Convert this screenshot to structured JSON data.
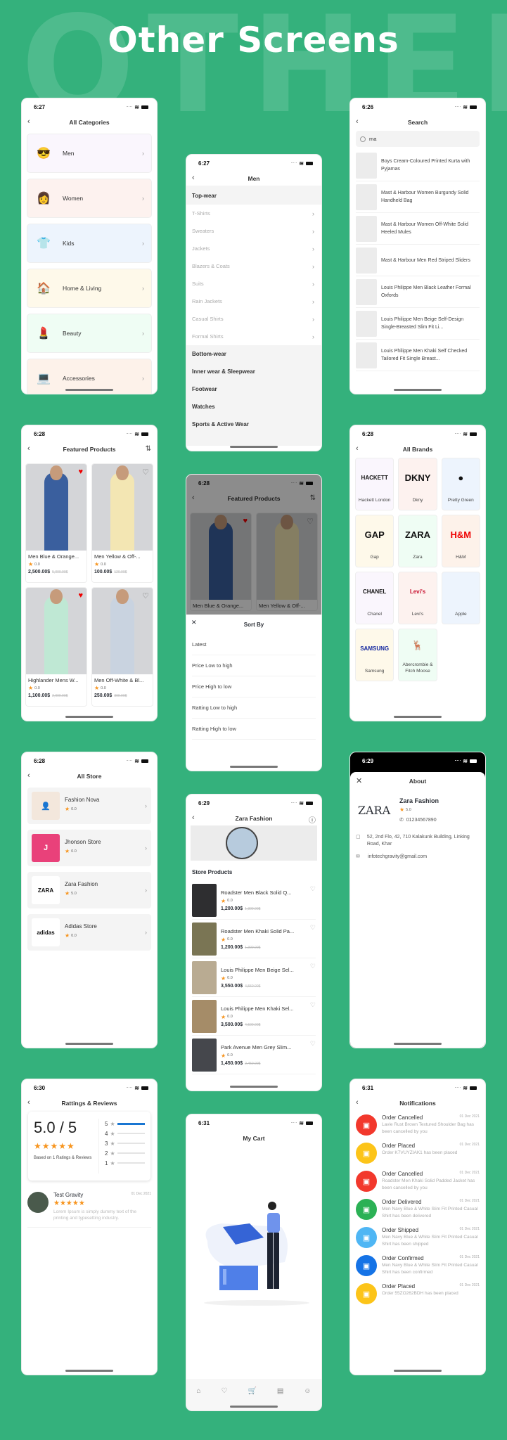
{
  "page": {
    "bg_word": "OTHER",
    "title": "Other Screens",
    "accent": "#34b17c",
    "star_color": "#f7941d"
  },
  "categories": {
    "time": "6:27",
    "title": "All Categories",
    "items": [
      {
        "label": "Men",
        "bg": "#faf6fd",
        "icon": "😎"
      },
      {
        "label": "Women",
        "bg": "#fdf2ef",
        "icon": "👩"
      },
      {
        "label": "Kids",
        "bg": "#edf4fd",
        "icon": "👕"
      },
      {
        "label": "Home & Living",
        "bg": "#fef9ea",
        "icon": "🏠"
      },
      {
        "label": "Beauty",
        "bg": "#effdf4",
        "icon": "💄"
      },
      {
        "label": "Accessories",
        "bg": "#fdf2ea",
        "icon": "💻"
      }
    ]
  },
  "men": {
    "time": "6:27",
    "title": "Men",
    "sections": [
      {
        "label": "Top-wear",
        "subs": [
          "T-Shirts",
          "Sweaters",
          "Jackets",
          "Blazers & Coats",
          "Suits",
          "Rain Jackets",
          "Casual Shirts",
          "Formal Shirts"
        ]
      },
      {
        "label": "Bottom-wear",
        "subs": []
      },
      {
        "label": "Inner wear & Sleepwear",
        "subs": []
      },
      {
        "label": "Footwear",
        "subs": []
      },
      {
        "label": "Watches",
        "subs": []
      },
      {
        "label": "Sports & Active Wear",
        "subs": []
      }
    ]
  },
  "search": {
    "time": "6:26",
    "title": "Search",
    "query": "ma",
    "results": [
      "Boys Cream-Coloured Printed Kurta with Pyjamas",
      "Mast & Harbour Women Burgundy Solid Handheld Bag",
      "Mast & Harbour Women Off-White Solid Heeled Mules",
      "Mast & Harbour Men Red Striped Sliders",
      "Louis Philippe Men Black Leather Formal Oxfords",
      "Louis Philippe Men Beige Self-Design Single-Breasted Slim Fit Li...",
      "Louis Philippe Men Khaki Self Checked Tailored Fit Single Breast..."
    ]
  },
  "featured": {
    "time": "6:28",
    "title": "Featured Products",
    "products": [
      {
        "name": "Men Blue & Orange...",
        "rating": "0.0",
        "price": "2,500.00$",
        "old": "5,000.00$",
        "fav": true,
        "color": "#3a5f9e"
      },
      {
        "name": "Men Yellow & Off-...",
        "rating": "0.0",
        "price": "100.00$",
        "old": "120.00$",
        "fav": false,
        "color": "#f3e6b3"
      },
      {
        "name": "Highlander Mens W...",
        "rating": "0.0",
        "price": "1,100.00$",
        "old": "2,000.00$",
        "fav": true,
        "color": "#bfe8d4"
      },
      {
        "name": "Men Off-White & Bl...",
        "rating": "0.0",
        "price": "250.00$",
        "old": "300.00$",
        "fav": false,
        "color": "#c9d3e0"
      }
    ]
  },
  "sort": {
    "time": "6:28",
    "title": "Featured Products",
    "sheet_title": "Sort By",
    "options": [
      "Latest",
      "Price Low to high",
      "Price High to low",
      "Ratting Low to high",
      "Ratting High to low"
    ],
    "peek": [
      "Men Blue & Orange...",
      "Men Yellow & Off-..."
    ]
  },
  "brands": {
    "time": "6:28",
    "title": "All Brands",
    "items": [
      {
        "name": "Hackett London",
        "logo": "HACKETT",
        "bg": "#faf6fd",
        "color": "#111"
      },
      {
        "name": "Dkny",
        "logo": "DKNY",
        "bg": "#fdf2ef",
        "color": "#111"
      },
      {
        "name": "Pretty Green",
        "logo": "●",
        "bg": "#edf4fd",
        "color": "#111"
      },
      {
        "name": "Gap",
        "logo": "GAP",
        "bg": "#fef9ea",
        "color": "#111"
      },
      {
        "name": "Zara",
        "logo": "ZARA",
        "bg": "#effdf4",
        "color": "#111"
      },
      {
        "name": "H&M",
        "logo": "H&M",
        "bg": "#fdf2ea",
        "color": "#e00"
      },
      {
        "name": "Chanel",
        "logo": "CHANEL",
        "bg": "#faf6fd",
        "color": "#111"
      },
      {
        "name": "Levi's",
        "logo": "Levi's",
        "bg": "#fdf2ef",
        "color": "#c8102e"
      },
      {
        "name": "Apple",
        "logo": "",
        "bg": "#edf4fd",
        "color": "#111"
      },
      {
        "name": "Samsung",
        "logo": "SAMSUNG",
        "bg": "#fef9ea",
        "color": "#1428a0"
      },
      {
        "name": "Abercrombie & Fitch Moose",
        "logo": "🦌",
        "bg": "#effdf4",
        "color": "#1d2f6f"
      }
    ]
  },
  "stores": {
    "time": "6:28",
    "title": "All Store",
    "items": [
      {
        "name": "Fashion Nova",
        "rating": "0.0",
        "logo": "👤",
        "logo_bg": "#f3e7dc",
        "logo_color": "#c99a6b"
      },
      {
        "name": "Jhonson Store",
        "rating": "0.0",
        "logo": "J",
        "logo_bg": "#e9417a",
        "logo_color": "#fff"
      },
      {
        "name": "Zara Fashion",
        "rating": "5.0",
        "logo": "ZARA",
        "logo_bg": "#fff",
        "logo_color": "#111"
      },
      {
        "name": "Adidas Store",
        "rating": "0.0",
        "logo": "adidas",
        "logo_bg": "#fff",
        "logo_color": "#111"
      }
    ]
  },
  "zara": {
    "time": "6:29",
    "title": "Zara Fashion",
    "section": "Store Products",
    "products": [
      {
        "name": "Roadster Men Black Solid Q...",
        "rating": "0.0",
        "price": "1,200.00$",
        "old": "1,300.00$",
        "color": "#2e2e30"
      },
      {
        "name": "Roadster Men Khaki Solid Pa...",
        "rating": "0.0",
        "price": "1,200.00$",
        "old": "1,300.00$",
        "color": "#7a7554"
      },
      {
        "name": "Louis Philippe Men Beige Sel...",
        "rating": "0.0",
        "price": "3,550.00$",
        "old": "4,550.00$",
        "color": "#b9ab92"
      },
      {
        "name": "Louis Philippe Men Khaki Sel...",
        "rating": "0.0",
        "price": "3,500.00$",
        "old": "4,500.00$",
        "color": "#a58c68"
      },
      {
        "name": "Park Avenue Men Grey Slim...",
        "rating": "0.0",
        "price": "1,450.00$",
        "old": "2,450.00$",
        "color": "#45474c"
      }
    ]
  },
  "about": {
    "time": "6:29",
    "title": "About",
    "store": "Zara Fashion",
    "logo": "ZARA",
    "rating": "5.0",
    "phone": "01234567890",
    "address": "52, 2nd Flo, 42, 710 Kalakunk Building, Linking Road, Khar",
    "email": "infotechgravity@gmail.com"
  },
  "ratings": {
    "time": "6:30",
    "title": "Rattings & Reviews",
    "score": "5.0 / 5",
    "based": "Based on 1 Ratings & Reviews",
    "bars": [
      {
        "star": "5",
        "fraction": 1.0
      },
      {
        "star": "4",
        "fraction": 0
      },
      {
        "star": "3",
        "fraction": 0
      },
      {
        "star": "2",
        "fraction": 0
      },
      {
        "star": "1",
        "fraction": 0
      }
    ],
    "review": {
      "user": "Test Gravity",
      "date": "01 Dec 2021",
      "stars": 5,
      "text": "Lorem Ipsum is simply dummy text of the printing and typesetting industry."
    }
  },
  "cart": {
    "time": "6:31",
    "title": "My Cart",
    "tabs": [
      "home",
      "heart",
      "cart",
      "orders",
      "profile"
    ]
  },
  "notifications": {
    "time": "6:31",
    "title": "Notifications",
    "items": [
      {
        "title": "Order Cancelled",
        "date": "01 Dec 2021",
        "msg": "Lavie Rust Brown Textured Shoulder Bag has been cancelled by you",
        "color": "#f2382c"
      },
      {
        "title": "Order Placed",
        "date": "01 Dec 2021",
        "msg": "Order K7VUYZIAK1 has been placed",
        "color": "#fcc419"
      },
      {
        "title": "Order Cancelled",
        "date": "01 Dec 2021",
        "msg": "Roadster Men Khaki Solid Padded Jacket has been cancelled by you",
        "color": "#f2382c"
      },
      {
        "title": "Order Delivered",
        "date": "01 Dec 2021",
        "msg": "Men Navy Blue & White Slim Fit Printed Casual Shirt has been delivered",
        "color": "#2bb155"
      },
      {
        "title": "Order Shipped",
        "date": "01 Dec 2021",
        "msg": "Men Navy Blue & White Slim Fit Printed Casual Shirt has been shipped",
        "color": "#4fb6f4"
      },
      {
        "title": "Order Confirmed",
        "date": "01 Dec 2021",
        "msg": "Men Navy Blue & White Slim Fit Printed Casual Shirt has been confirmed",
        "color": "#1573e6"
      },
      {
        "title": "Order Placed",
        "date": "01 Dec 2021",
        "msg": "Order 55ZO262BDH has been placed",
        "color": "#fcc419"
      }
    ]
  }
}
